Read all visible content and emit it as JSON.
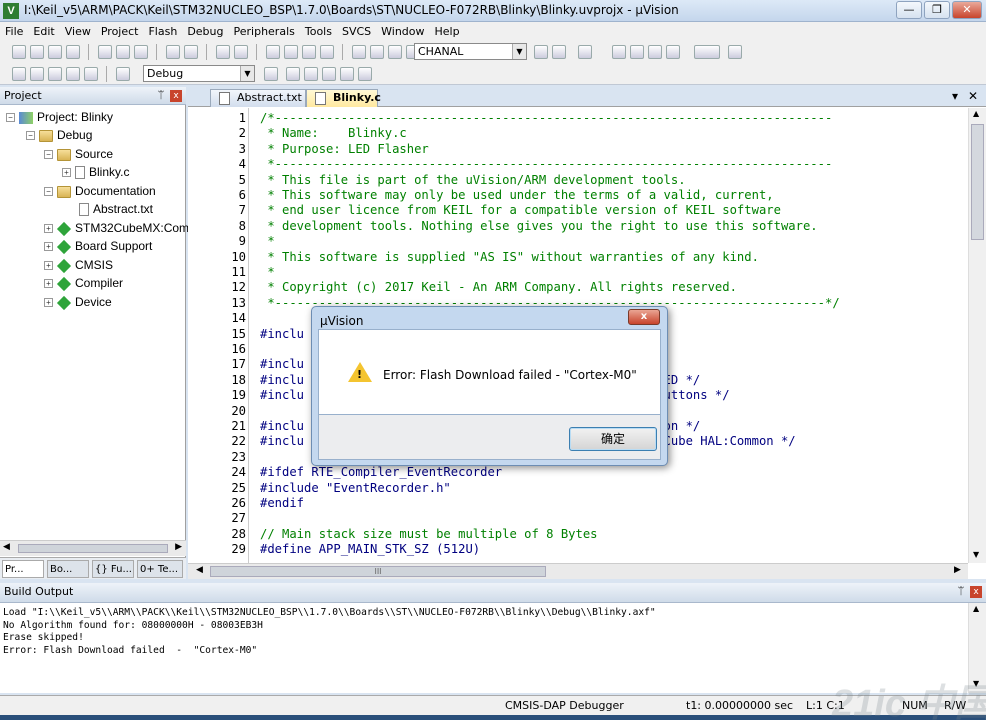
{
  "window": {
    "title": "I:\\Keil_v5\\ARM\\PACK\\Keil\\STM32NUCLEO_BSP\\1.7.0\\Boards\\ST\\NUCLEO-F072RB\\Blinky\\Blinky.uvprojx - µVision",
    "app_icon": "V",
    "minimize": "—",
    "maximize": "❐",
    "close": "✕"
  },
  "menu": [
    "File",
    "Edit",
    "View",
    "Project",
    "Flash",
    "Debug",
    "Peripherals",
    "Tools",
    "SVCS",
    "Window",
    "Help"
  ],
  "toolbar": {
    "find_combo": "CHANAL",
    "target_combo": "Debug"
  },
  "project": {
    "header": "Project",
    "pin": "ᛠ",
    "close": "x",
    "tree": [
      {
        "label": "Project: Blinky",
        "icon": "project-icon"
      },
      {
        "label": "Debug",
        "icon": "folder-icon"
      },
      {
        "label": "Source",
        "icon": "folder-icon"
      },
      {
        "label": "Blinky.c",
        "icon": "file-icon"
      },
      {
        "label": "Documentation",
        "icon": "folder-icon"
      },
      {
        "label": "Abstract.txt",
        "icon": "file-icon"
      },
      {
        "label": "STM32CubeMX:Com",
        "icon": "component-icon"
      },
      {
        "label": "Board Support",
        "icon": "component-icon"
      },
      {
        "label": "CMSIS",
        "icon": "component-icon"
      },
      {
        "label": "Compiler",
        "icon": "component-icon"
      },
      {
        "label": "Device",
        "icon": "component-icon"
      }
    ],
    "tabs": [
      "Pr...",
      "Bo...",
      "{} Fu...",
      "0+ Te..."
    ]
  },
  "editor": {
    "tabs": [
      "Abstract.txt",
      "Blinky.c"
    ],
    "dropdown": "▾",
    "close": "✕",
    "lines": [
      {
        "n": "1",
        "t": "/*----------------------------------------------------------------------------",
        "c": "cm"
      },
      {
        "n": "2",
        "t": " * Name:    Blinky.c",
        "c": "cm"
      },
      {
        "n": "3",
        "t": " * Purpose: LED Flasher",
        "c": "cm"
      },
      {
        "n": "4",
        "t": " *----------------------------------------------------------------------------",
        "c": "cm"
      },
      {
        "n": "5",
        "t": " * This file is part of the uVision/ARM development tools.",
        "c": "cm"
      },
      {
        "n": "6",
        "t": " * This software may only be used under the terms of a valid, current,",
        "c": "cm"
      },
      {
        "n": "7",
        "t": " * end user licence from KEIL for a compatible version of KEIL software",
        "c": "cm"
      },
      {
        "n": "8",
        "t": " * development tools. Nothing else gives you the right to use this software.",
        "c": "cm"
      },
      {
        "n": "9",
        "t": " *",
        "c": "cm"
      },
      {
        "n": "10",
        "t": " * This software is supplied \"AS IS\" without warranties of any kind.",
        "c": "cm"
      },
      {
        "n": "11",
        "t": " *",
        "c": "cm"
      },
      {
        "n": "12",
        "t": " * Copyright (c) 2017 Keil - An ARM Company. All rights reserved.",
        "c": "cm"
      },
      {
        "n": "13",
        "t": " *---------------------------------------------------------------------------*/",
        "c": "cm"
      },
      {
        "n": "14",
        "t": "",
        "c": ""
      },
      {
        "n": "15",
        "t": "#inclu",
        "c": "pp"
      },
      {
        "n": "16",
        "t": "",
        "c": ""
      },
      {
        "n": "17",
        "t": "#inclu",
        "c": "pp"
      },
      {
        "n": "18",
        "t": "#inclu                                          pport:LED */",
        "c": "pp"
      },
      {
        "n": "19",
        "t": "#inclu                                          pport:Buttons */",
        "c": "pp"
      },
      {
        "n": "20",
        "t": "",
        "c": ""
      },
      {
        "n": "21",
        "t": "#inclu                                          selection */",
        "c": "pp"
      },
      {
        "n": "22",
        "t": "#inclu                                          e:STM32Cube HAL:Common */",
        "c": "pp"
      },
      {
        "n": "23",
        "t": "",
        "c": ""
      },
      {
        "n": "24",
        "t": "#ifdef RTE_Compiler_EventRecorder",
        "c": "pp"
      },
      {
        "n": "25",
        "t": "#include \"EventRecorder.h\"",
        "c": "pp"
      },
      {
        "n": "26",
        "t": "#endif",
        "c": "pp"
      },
      {
        "n": "27",
        "t": "",
        "c": ""
      },
      {
        "n": "28",
        "t": "// Main stack size must be multiple of 8 Bytes",
        "c": "cm"
      },
      {
        "n": "29",
        "t": "#define APP_MAIN_STK_SZ (512U)",
        "c": "pp"
      }
    ],
    "hscroll_grip": "III"
  },
  "build": {
    "header": "Build Output",
    "pin": "ᛠ",
    "close": "x",
    "text": "Load \"I:\\\\Keil_v5\\\\ARM\\\\PACK\\\\Keil\\\\STM32NUCLEO_BSP\\\\1.7.0\\\\Boards\\\\ST\\\\NUCLEO-F072RB\\\\Blinky\\\\Debug\\\\Blinky.axf\"\nNo Algorithm found for: 08000000H - 08003EB3H\nErase skipped!\nError: Flash Download failed  -  \"Cortex-M0\""
  },
  "status": {
    "debugger": "CMSIS-DAP Debugger",
    "time": "t1: 0.00000000 sec",
    "pos": "L:1 C:1",
    "num": "NUM",
    "rw": "R/W"
  },
  "dialog": {
    "title": "µVision",
    "close": "x",
    "message": "Error: Flash Download failed  -  \"Cortex-M0\"",
    "warn_glyph": "!",
    "ok": "确定"
  },
  "watermark": "21ic 中国电子网"
}
